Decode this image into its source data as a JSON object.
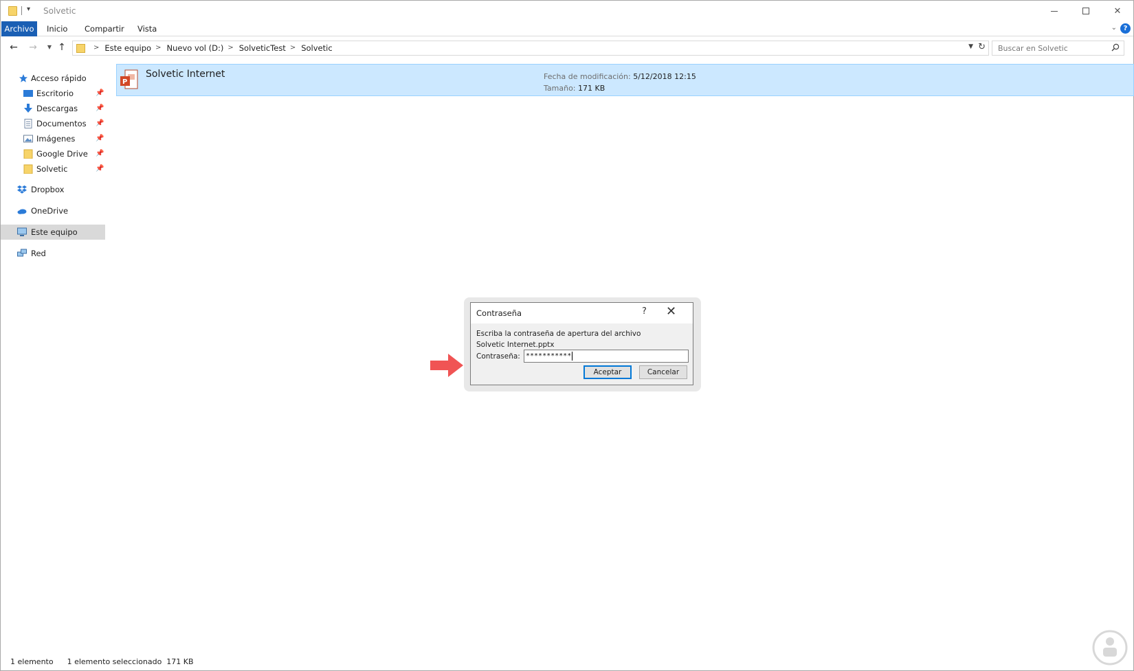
{
  "window": {
    "title": "Solvetic",
    "quick_access_toolbar": "▾"
  },
  "ribbon": {
    "tabs": [
      "Archivo",
      "Inicio",
      "Compartir",
      "Vista"
    ],
    "help": "?"
  },
  "address_bar": {
    "crumbs": [
      "Este equipo",
      "Nuevo vol (D:)",
      "SolveticTest",
      "Solvetic"
    ]
  },
  "search": {
    "placeholder": "Buscar en Solvetic"
  },
  "sidebar": {
    "quick_access": "Acceso rápido",
    "items": [
      {
        "label": "Escritorio",
        "icon": "desktop-icon",
        "pinned": true
      },
      {
        "label": "Descargas",
        "icon": "download-icon",
        "pinned": true
      },
      {
        "label": "Documentos",
        "icon": "document-icon",
        "pinned": true
      },
      {
        "label": "Imágenes",
        "icon": "images-icon",
        "pinned": true
      },
      {
        "label": "Google Drive",
        "icon": "folder-icon",
        "pinned": true
      },
      {
        "label": "Solvetic",
        "icon": "folder-icon",
        "pinned": true
      }
    ],
    "dropbox": "Dropbox",
    "onedrive": "OneDrive",
    "this_pc": "Este equipo",
    "network": "Red"
  },
  "file": {
    "name": "Solvetic Internet",
    "modified_label": "Fecha de modificación:",
    "modified_value": "5/12/2018 12:15",
    "size_label": "Tamaño:",
    "size_value": "171 KB"
  },
  "status_bar": {
    "count": "1 elemento",
    "selected": "1 elemento seleccionado  171 KB"
  },
  "dialog": {
    "title": "Contraseña",
    "help": "?",
    "message_line1": "Escriba la contraseña de apertura del archivo",
    "message_line2": "Solvetic Internet.pptx",
    "password_label": "Contraseña:",
    "password_value": "***********",
    "ok_label": "Aceptar",
    "cancel_label": "Cancelar"
  },
  "colors": {
    "accent": "#1a5fb4",
    "selection": "#cce8ff",
    "arrow": "#f05454"
  }
}
